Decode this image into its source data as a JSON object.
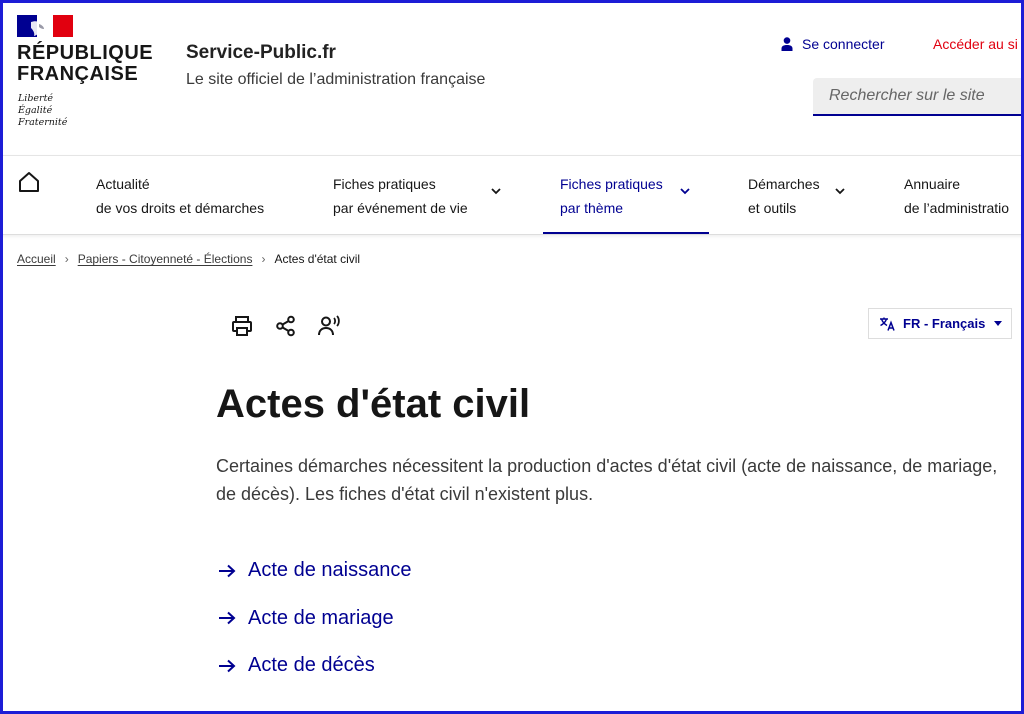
{
  "header": {
    "logo": {
      "name_line1": "RÉPUBLIQUE",
      "name_line2": "FRANÇAISE",
      "motto1": "Liberté",
      "motto2": "Égalité",
      "motto3": "Fraternité",
      "flag_colors": [
        "#000091",
        "#ffffff",
        "#e1000f"
      ]
    },
    "site_title": "Service-Public.fr",
    "site_subtitle": "Le site officiel de l’administration française",
    "connect_label": "Se connecter",
    "connect_icon": "user-icon",
    "acceder_label": "Accéder au si",
    "search_placeholder": "Rechercher sur le site"
  },
  "nav": {
    "home_icon": "home-icon",
    "items": [
      {
        "line1": "Actualité",
        "line2": "de vos droits et démarches",
        "dropdown": false
      },
      {
        "line1": "Fiches pratiques",
        "line2": "par événement de vie",
        "dropdown": true
      },
      {
        "line1": "Fiches pratiques",
        "line2": "par thème",
        "dropdown": true,
        "active": true
      },
      {
        "line1": "Démarches",
        "line2": "et outils",
        "dropdown": true
      },
      {
        "line1": "Annuaire",
        "line2": "de l’administratio",
        "dropdown": false
      }
    ]
  },
  "breadcrumb": {
    "items": [
      "Accueil",
      "Papiers - Citoyenneté - Élections"
    ],
    "current": "Actes d'état civil"
  },
  "tools": {
    "icons": [
      "print-icon",
      "share-icon",
      "listen-icon"
    ],
    "language_label": "FR - Français"
  },
  "content": {
    "title": "Actes d'état civil",
    "intro": "Certaines démarches nécessitent la production d'actes d'état civil (acte de naissance, de mariage, de décès). Les fiches d'état civil n'existent plus.",
    "links": [
      "Acte de naissance",
      "Acte de mariage",
      "Acte de décès"
    ]
  },
  "colors": {
    "primary_blue": "#000091",
    "marianne_red": "#e1000f",
    "frame_border": "#1d1dd6"
  }
}
